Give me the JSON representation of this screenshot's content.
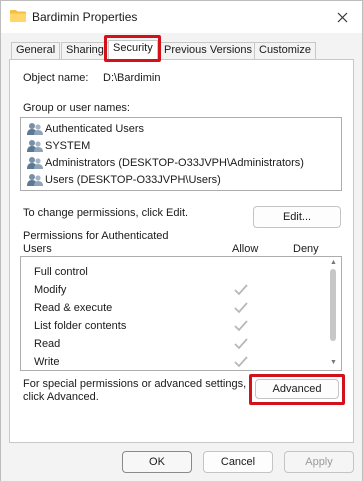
{
  "window": {
    "title": "Bardimin Properties"
  },
  "tabs": [
    {
      "label": "General"
    },
    {
      "label": "Sharing"
    },
    {
      "label": "Security"
    },
    {
      "label": "Previous Versions"
    },
    {
      "label": "Customize"
    }
  ],
  "security": {
    "object_name_label": "Object name:",
    "object_name_value": "D:\\Bardimin",
    "group_label": "Group or user names:",
    "users": [
      {
        "name": "Authenticated Users"
      },
      {
        "name": "SYSTEM"
      },
      {
        "name": "Administrators (DESKTOP-O33JVPH\\Administrators)"
      },
      {
        "name": "Users (DESKTOP-O33JVPH\\Users)"
      }
    ],
    "change_hint": "To change permissions, click Edit.",
    "edit_button": "Edit...",
    "permissions_for_line1": "Permissions for Authenticated",
    "permissions_for_line2": "Users",
    "allow_header": "Allow",
    "deny_header": "Deny",
    "permissions": [
      {
        "name": "Full control"
      },
      {
        "name": "Modify"
      },
      {
        "name": "Read & execute"
      },
      {
        "name": "List folder contents"
      },
      {
        "name": "Read"
      },
      {
        "name": "Write"
      }
    ],
    "special_line1": "For special permissions or advanced settings,",
    "special_line2": "click Advanced.",
    "advanced_button": "Advanced"
  },
  "footer": {
    "ok": "OK",
    "cancel": "Cancel",
    "apply": "Apply"
  },
  "colors": {
    "highlight": "#d2121b",
    "check": "#b8b8b8"
  },
  "icons": {
    "folder": "folder-icon",
    "users": "users-icon",
    "close": "close-icon",
    "check": "check-icon"
  }
}
